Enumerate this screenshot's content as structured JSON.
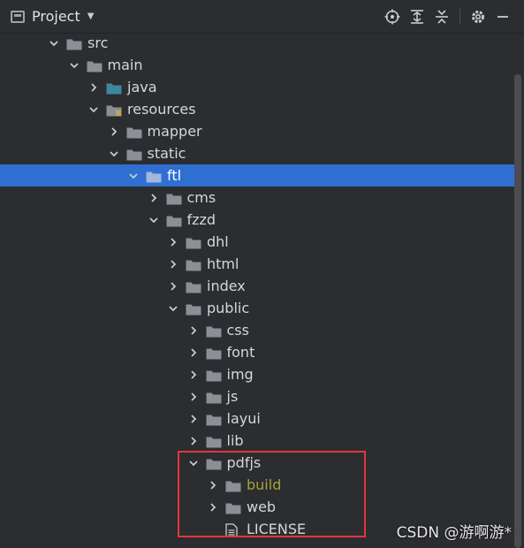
{
  "toolbar": {
    "title": "Project",
    "icons": [
      "window-icon",
      "dropdown-caret-icon",
      "locate-icon",
      "expand-all-icon",
      "collapse-all-icon",
      "gear-icon",
      "minimize-icon"
    ]
  },
  "tree": {
    "rows": [
      {
        "label": "src",
        "depth": 0,
        "expanded": true,
        "type": "folder"
      },
      {
        "label": "main",
        "depth": 1,
        "expanded": true,
        "type": "folder"
      },
      {
        "label": "java",
        "depth": 2,
        "expanded": false,
        "type": "source-folder"
      },
      {
        "label": "resources",
        "depth": 2,
        "expanded": true,
        "type": "resource-folder"
      },
      {
        "label": "mapper",
        "depth": 3,
        "expanded": false,
        "type": "folder"
      },
      {
        "label": "static",
        "depth": 3,
        "expanded": true,
        "type": "folder"
      },
      {
        "label": "ftl",
        "depth": 4,
        "expanded": true,
        "type": "folder",
        "selected": true
      },
      {
        "label": "cms",
        "depth": 5,
        "expanded": false,
        "type": "folder"
      },
      {
        "label": "fzzd",
        "depth": 5,
        "expanded": true,
        "type": "folder"
      },
      {
        "label": "dhl",
        "depth": 6,
        "expanded": false,
        "type": "folder"
      },
      {
        "label": "html",
        "depth": 6,
        "expanded": false,
        "type": "folder"
      },
      {
        "label": "index",
        "depth": 6,
        "expanded": false,
        "type": "folder"
      },
      {
        "label": "public",
        "depth": 6,
        "expanded": true,
        "type": "folder"
      },
      {
        "label": "css",
        "depth": 7,
        "expanded": false,
        "type": "folder"
      },
      {
        "label": "font",
        "depth": 7,
        "expanded": false,
        "type": "folder"
      },
      {
        "label": "img",
        "depth": 7,
        "expanded": false,
        "type": "folder"
      },
      {
        "label": "js",
        "depth": 7,
        "expanded": false,
        "type": "folder"
      },
      {
        "label": "layui",
        "depth": 7,
        "expanded": false,
        "type": "folder"
      },
      {
        "label": "lib",
        "depth": 7,
        "expanded": false,
        "type": "folder"
      },
      {
        "label": "pdfjs",
        "depth": 7,
        "expanded": true,
        "type": "folder"
      },
      {
        "label": "build",
        "depth": 8,
        "expanded": false,
        "type": "folder",
        "excluded": true
      },
      {
        "label": "web",
        "depth": 8,
        "expanded": false,
        "type": "folder"
      },
      {
        "label": "LICENSE",
        "depth": 8,
        "type": "file"
      }
    ]
  },
  "watermark": "CSDN @游啊游*",
  "colors": {
    "background": "#2b2d30",
    "selection": "#2f6fd1",
    "folder": "#8b9096",
    "source_folder": "#3e86a0",
    "excluded_text": "#a7a332",
    "highlight_border": "#e0383b"
  }
}
